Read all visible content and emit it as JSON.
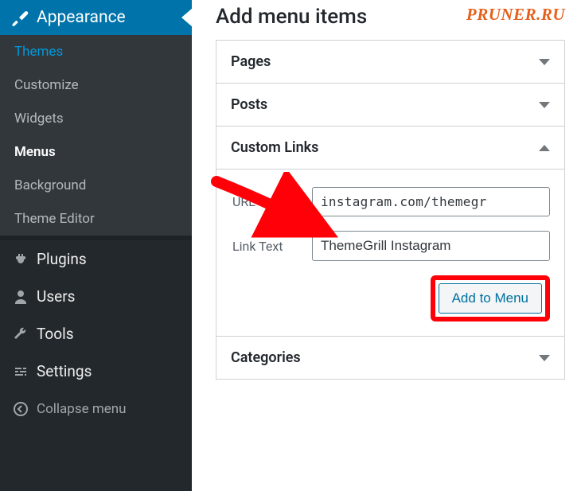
{
  "sidebar": {
    "active_top": "Appearance",
    "submenu": [
      {
        "label": "Themes",
        "class": "themes"
      },
      {
        "label": "Customize",
        "class": ""
      },
      {
        "label": "Widgets",
        "class": ""
      },
      {
        "label": "Menus",
        "class": "current"
      },
      {
        "label": "Background",
        "class": ""
      },
      {
        "label": "Theme Editor",
        "class": ""
      }
    ],
    "items": [
      {
        "label": "Plugins",
        "icon": "plug"
      },
      {
        "label": "Users",
        "icon": "user"
      },
      {
        "label": "Tools",
        "icon": "wrench"
      },
      {
        "label": "Settings",
        "icon": "sliders"
      }
    ],
    "collapse": "Collapse menu"
  },
  "title": "Add menu items",
  "watermark": "PRUNER.RU",
  "accordions": {
    "pages": "Pages",
    "posts": "Posts",
    "custom": "Custom Links",
    "categories": "Categories"
  },
  "custom_links": {
    "url_label": "URL",
    "url_value": "instagram.com/themegr",
    "text_label": "Link Text",
    "text_value": "ThemeGrill Instagram",
    "button": "Add to Menu"
  }
}
